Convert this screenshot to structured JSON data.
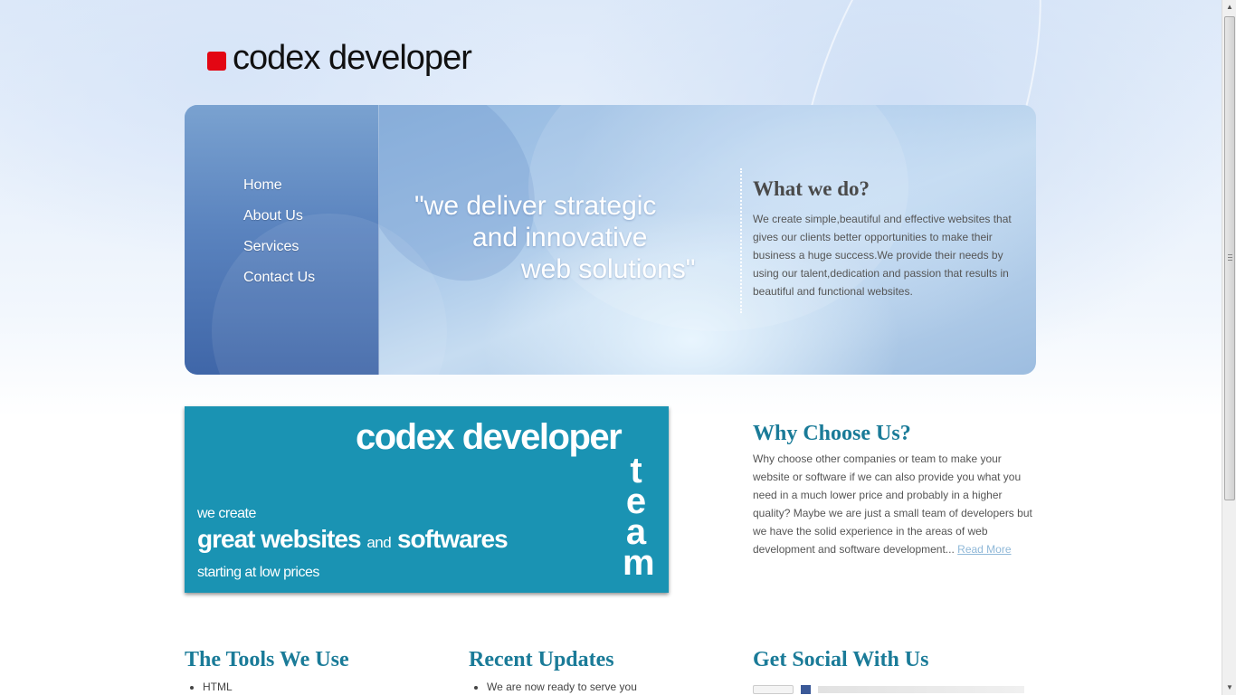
{
  "logo": {
    "text": "codex developer",
    "mark_color": "#e30613"
  },
  "nav": {
    "items": [
      {
        "label": "Home"
      },
      {
        "label": "About Us"
      },
      {
        "label": "Services"
      },
      {
        "label": "Contact Us"
      }
    ]
  },
  "hero": {
    "tagline": [
      "\"we deliver strategic",
      "and innovative",
      "web solutions\""
    ]
  },
  "what_we_do": {
    "title": "What we do?",
    "text": "We create simple,beautiful and effective websites that gives our clients better opportunities to make their business a huge success.We provide their needs by using our talent,dedication and passion that results in beautiful and functional websites."
  },
  "banner": {
    "title": "codex developer",
    "team_letters": [
      "t",
      "e",
      "a",
      "m"
    ],
    "line1": "we create",
    "line2_a": "great websites",
    "line2_b": "and",
    "line2_c": "softwares",
    "line3": "starting at low prices",
    "bg_color": "#1a93b3"
  },
  "why_choose": {
    "title": "Why Choose Us?",
    "text": "Why choose other companies or team to make your website or software if we can also provide you what you need in a much lower price and probably in a higher quality? Maybe we are just a small team of developers but we have the solid experience in the areas of web development and software development...",
    "read_more": "Read More"
  },
  "tools": {
    "title": "The Tools We Use",
    "items": [
      "HTML"
    ]
  },
  "updates": {
    "title": "Recent Updates",
    "items": [
      "We are now ready to serve you"
    ]
  },
  "social": {
    "title": "Get Social With Us"
  },
  "colors": {
    "heading": "#1a7b98",
    "nav_panel": "#4f78b5"
  }
}
